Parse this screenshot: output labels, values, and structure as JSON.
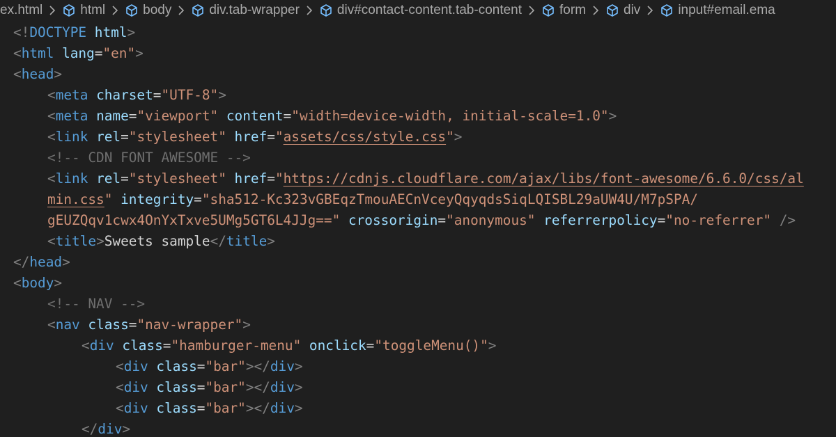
{
  "breadcrumb": {
    "items": [
      {
        "label": "ex.html",
        "icon": false
      },
      {
        "label": "html",
        "icon": true
      },
      {
        "label": "body",
        "icon": true
      },
      {
        "label": "div.tab-wrapper",
        "icon": true
      },
      {
        "label": "div#contact-content.tab-content",
        "icon": true
      },
      {
        "label": "form",
        "icon": true
      },
      {
        "label": "div",
        "icon": true
      },
      {
        "label": "input#email.ema",
        "icon": true
      }
    ]
  },
  "colors": {
    "background": "#1f1f1f",
    "tag": "#569cd6",
    "attribute": "#9cdcfe",
    "string": "#ce9178",
    "punctuation": "#808080",
    "text": "#d4d4d4",
    "comment": "#6f6f6f"
  },
  "code": {
    "lines": [
      {
        "indent": 0,
        "tokens": [
          [
            "punc",
            "<!"
          ],
          [
            "doct",
            "DOCTYPE "
          ],
          [
            "attr",
            "html"
          ],
          [
            "punc",
            ">"
          ]
        ]
      },
      {
        "indent": 0,
        "tokens": [
          [
            "punc",
            "<"
          ],
          [
            "tag",
            "html "
          ],
          [
            "attr",
            "lang"
          ],
          [
            "txt",
            "="
          ],
          [
            "str",
            "\"en\""
          ],
          [
            "punc",
            ">"
          ]
        ]
      },
      {
        "indent": 0,
        "tokens": [
          [
            "punc",
            "<"
          ],
          [
            "tag",
            "head"
          ],
          [
            "punc",
            ">"
          ]
        ]
      },
      {
        "indent": 1,
        "tokens": [
          [
            "punc",
            "<"
          ],
          [
            "tag",
            "meta "
          ],
          [
            "attr",
            "charset"
          ],
          [
            "txt",
            "="
          ],
          [
            "str",
            "\"UTF-8\""
          ],
          [
            "punc",
            ">"
          ]
        ]
      },
      {
        "indent": 1,
        "tokens": [
          [
            "punc",
            "<"
          ],
          [
            "tag",
            "meta "
          ],
          [
            "attr",
            "name"
          ],
          [
            "txt",
            "="
          ],
          [
            "str",
            "\"viewport\" "
          ],
          [
            "attr",
            "content"
          ],
          [
            "txt",
            "="
          ],
          [
            "str",
            "\"width=device-width, initial-scale=1.0\""
          ],
          [
            "punc",
            ">"
          ]
        ]
      },
      {
        "indent": 1,
        "tokens": [
          [
            "punc",
            "<"
          ],
          [
            "tag",
            "link "
          ],
          [
            "attr",
            "rel"
          ],
          [
            "txt",
            "="
          ],
          [
            "str",
            "\"stylesheet\" "
          ],
          [
            "attr",
            "href"
          ],
          [
            "txt",
            "="
          ],
          [
            "str",
            "\""
          ],
          [
            "strlink",
            "assets/css/style.css"
          ],
          [
            "str",
            "\""
          ],
          [
            "punc",
            ">"
          ]
        ]
      },
      {
        "indent": 1,
        "tokens": [
          [
            "cmt",
            "<!-- CDN FONT AWESOME -->"
          ]
        ]
      },
      {
        "indent": 1,
        "tokens": [
          [
            "punc",
            "<"
          ],
          [
            "tag",
            "link "
          ],
          [
            "attr",
            "rel"
          ],
          [
            "txt",
            "="
          ],
          [
            "str",
            "\"stylesheet\" "
          ],
          [
            "attr",
            "href"
          ],
          [
            "txt",
            "="
          ],
          [
            "str",
            "\""
          ],
          [
            "strlink",
            "https://cdnjs.cloudflare.com/ajax/libs/font-awesome/6.6.0/css/al"
          ]
        ]
      },
      {
        "indent": 1,
        "tokens": [
          [
            "strlink",
            "min.css"
          ],
          [
            "str",
            "\" "
          ],
          [
            "attr",
            "integrity"
          ],
          [
            "txt",
            "="
          ],
          [
            "str",
            "\"sha512-Kc323vGBEqzTmouAECnVceyQqyqdsSiqLQISBL29aUW4U/M7pSPA/"
          ]
        ]
      },
      {
        "indent": 1,
        "tokens": [
          [
            "str",
            "gEUZQqv1cwx4OnYxTxve5UMg5GT6L4JJg==\" "
          ],
          [
            "attr",
            "crossorigin"
          ],
          [
            "txt",
            "="
          ],
          [
            "str",
            "\"anonymous\" "
          ],
          [
            "attr",
            "referrerpolicy"
          ],
          [
            "txt",
            "="
          ],
          [
            "str",
            "\"no-referrer\" "
          ],
          [
            "punc",
            "/>"
          ]
        ]
      },
      {
        "indent": 1,
        "tokens": [
          [
            "punc",
            "<"
          ],
          [
            "tag",
            "title"
          ],
          [
            "punc",
            ">"
          ],
          [
            "txt",
            "Sweets sample"
          ],
          [
            "punc",
            "</"
          ],
          [
            "tag",
            "title"
          ],
          [
            "punc",
            ">"
          ]
        ]
      },
      {
        "indent": 0,
        "tokens": [
          [
            "punc",
            "</"
          ],
          [
            "tag",
            "head"
          ],
          [
            "punc",
            ">"
          ]
        ]
      },
      {
        "indent": 0,
        "tokens": [
          [
            "punc",
            "<"
          ],
          [
            "tag",
            "body"
          ],
          [
            "punc",
            ">"
          ]
        ]
      },
      {
        "indent": 1,
        "tokens": [
          [
            "cmt",
            "<!-- NAV -->"
          ]
        ]
      },
      {
        "indent": 1,
        "tokens": [
          [
            "punc",
            "<"
          ],
          [
            "tag",
            "nav "
          ],
          [
            "attr",
            "class"
          ],
          [
            "txt",
            "="
          ],
          [
            "str",
            "\"nav-wrapper\""
          ],
          [
            "punc",
            ">"
          ]
        ]
      },
      {
        "indent": 2,
        "tokens": [
          [
            "punc",
            "<"
          ],
          [
            "tag",
            "div "
          ],
          [
            "attr",
            "class"
          ],
          [
            "txt",
            "="
          ],
          [
            "str",
            "\"hamburger-menu\" "
          ],
          [
            "attr",
            "onclick"
          ],
          [
            "txt",
            "="
          ],
          [
            "str",
            "\"toggleMenu()\""
          ],
          [
            "punc",
            ">"
          ]
        ]
      },
      {
        "indent": 3,
        "tokens": [
          [
            "punc",
            "<"
          ],
          [
            "tag",
            "div "
          ],
          [
            "attr",
            "class"
          ],
          [
            "txt",
            "="
          ],
          [
            "str",
            "\"bar\""
          ],
          [
            "punc",
            "></"
          ],
          [
            "tag",
            "div"
          ],
          [
            "punc",
            ">"
          ]
        ]
      },
      {
        "indent": 3,
        "tokens": [
          [
            "punc",
            "<"
          ],
          [
            "tag",
            "div "
          ],
          [
            "attr",
            "class"
          ],
          [
            "txt",
            "="
          ],
          [
            "str",
            "\"bar\""
          ],
          [
            "punc",
            "></"
          ],
          [
            "tag",
            "div"
          ],
          [
            "punc",
            ">"
          ]
        ]
      },
      {
        "indent": 3,
        "tokens": [
          [
            "punc",
            "<"
          ],
          [
            "tag",
            "div "
          ],
          [
            "attr",
            "class"
          ],
          [
            "txt",
            "="
          ],
          [
            "str",
            "\"bar\""
          ],
          [
            "punc",
            "></"
          ],
          [
            "tag",
            "div"
          ],
          [
            "punc",
            ">"
          ]
        ]
      },
      {
        "indent": 2,
        "tokens": [
          [
            "punc",
            "</"
          ],
          [
            "tag",
            "div"
          ],
          [
            "punc",
            ">"
          ]
        ]
      }
    ]
  }
}
